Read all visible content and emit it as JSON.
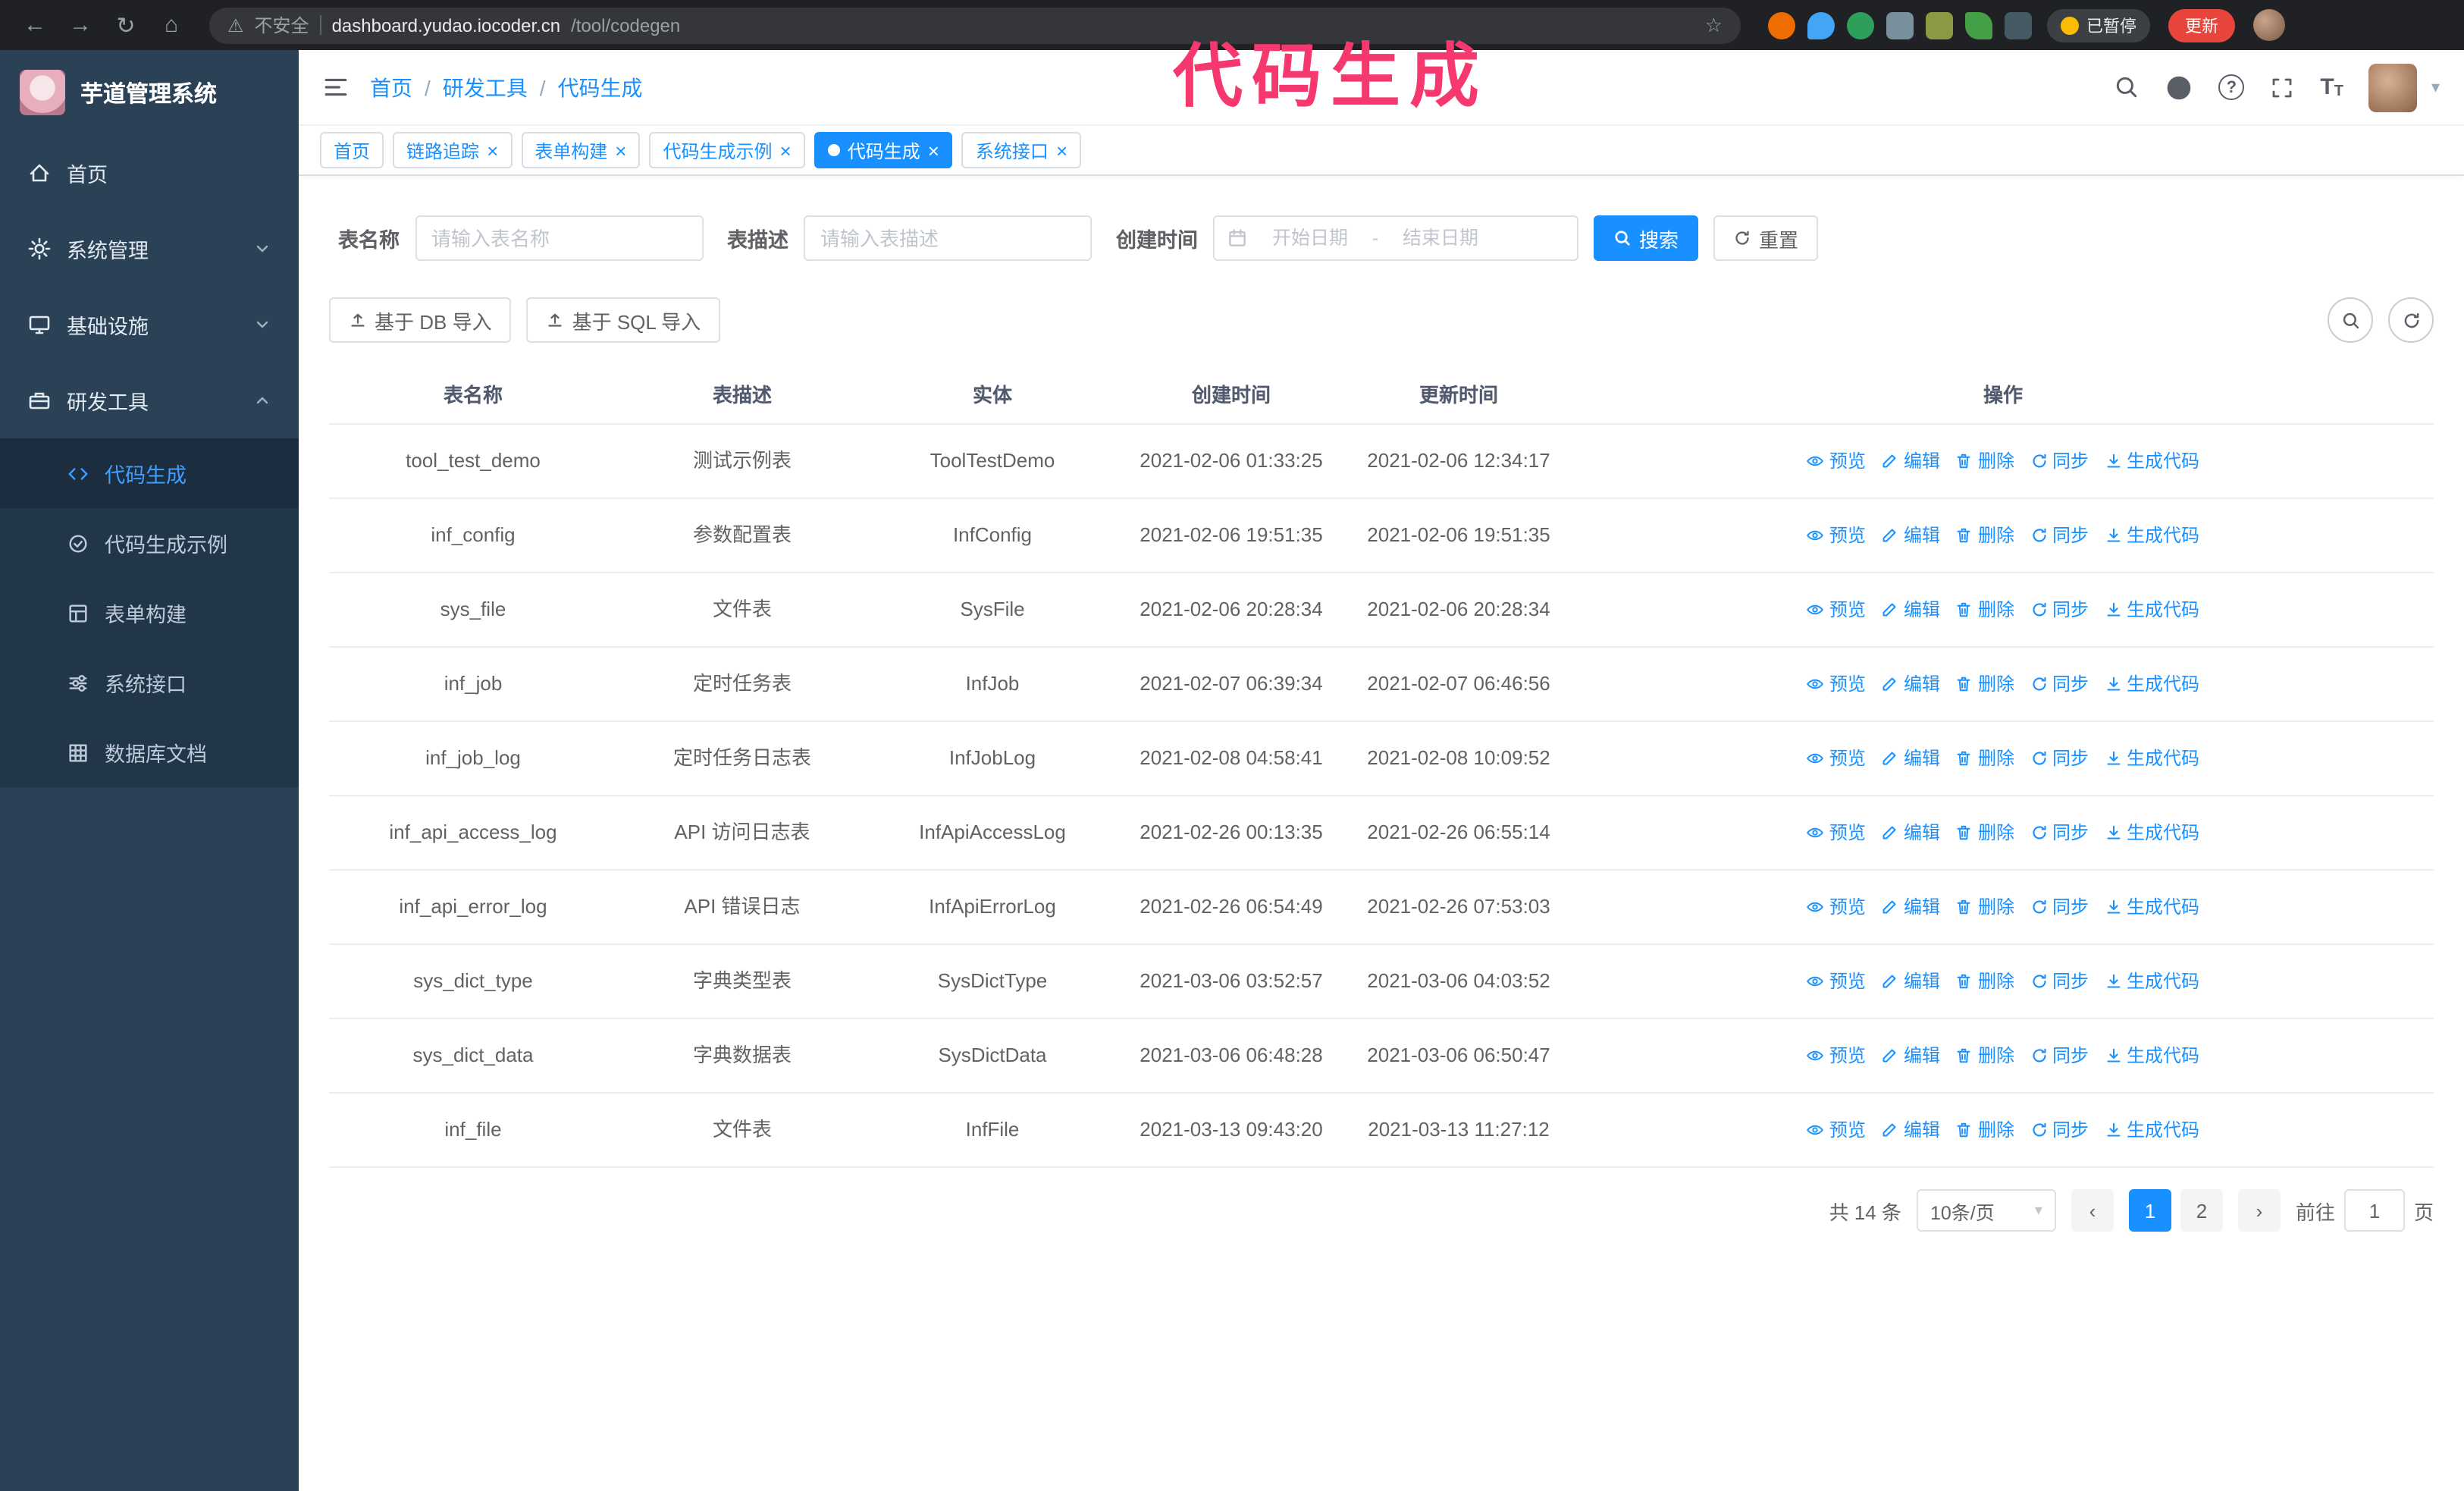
{
  "colors": {
    "accent": "#1890ff",
    "annotation": "#f5386e",
    "sidebar_bg": "#2b4156",
    "chrome_bg": "#202124",
    "update_button_bg": "#e8453c",
    "active_tab_bg": "#1890ff"
  },
  "browser": {
    "security_label": "不安全",
    "url_host": "dashboard.yudao.iocoder.cn",
    "url_path": "/tool/codegen",
    "paused_badge": "已暂停",
    "update_button": "更新"
  },
  "annotation": {
    "text": "代码生成"
  },
  "sidebar": {
    "title": "芋道管理系统",
    "items": [
      {
        "label": "首页"
      },
      {
        "label": "系统管理"
      },
      {
        "label": "基础设施"
      },
      {
        "label": "研发工具"
      }
    ],
    "subitems": [
      {
        "label": "代码生成"
      },
      {
        "label": "代码生成示例"
      },
      {
        "label": "表单构建"
      },
      {
        "label": "系统接口"
      },
      {
        "label": "数据库文档"
      }
    ]
  },
  "header": {
    "breadcrumb": [
      "首页",
      "研发工具",
      "代码生成"
    ]
  },
  "tabs": [
    {
      "label": "首页",
      "closable": false,
      "active": false
    },
    {
      "label": "链路追踪",
      "closable": true,
      "active": false
    },
    {
      "label": "表单构建",
      "closable": true,
      "active": false
    },
    {
      "label": "代码生成示例",
      "closable": true,
      "active": false
    },
    {
      "label": "代码生成",
      "closable": true,
      "active": true
    },
    {
      "label": "系统接口",
      "closable": true,
      "active": false
    }
  ],
  "filters": {
    "table_name_label": "表名称",
    "table_name_placeholder": "请输入表名称",
    "table_desc_label": "表描述",
    "table_desc_placeholder": "请输入表描述",
    "create_time_label": "创建时间",
    "date_start_placeholder": "开始日期",
    "date_separator": "-",
    "date_end_placeholder": "结束日期",
    "search_button": "搜索",
    "reset_button": "重置"
  },
  "toolbar": {
    "import_db_button": "基于 DB 导入",
    "import_sql_button": "基于 SQL 导入"
  },
  "table": {
    "columns": [
      "表名称",
      "表描述",
      "实体",
      "创建时间",
      "更新时间",
      "操作"
    ],
    "row_actions": [
      "预览",
      "编辑",
      "删除",
      "同步",
      "生成代码"
    ],
    "rows": [
      {
        "name": "tool_test_demo",
        "desc": "测试示例表",
        "entity": "ToolTestDemo",
        "created": "2021-02-06 01:33:25",
        "updated": "2021-02-06 12:34:17"
      },
      {
        "name": "inf_config",
        "desc": "参数配置表",
        "entity": "InfConfig",
        "created": "2021-02-06 19:51:35",
        "updated": "2021-02-06 19:51:35"
      },
      {
        "name": "sys_file",
        "desc": "文件表",
        "entity": "SysFile",
        "created": "2021-02-06 20:28:34",
        "updated": "2021-02-06 20:28:34"
      },
      {
        "name": "inf_job",
        "desc": "定时任务表",
        "entity": "InfJob",
        "created": "2021-02-07 06:39:34",
        "updated": "2021-02-07 06:46:56"
      },
      {
        "name": "inf_job_log",
        "desc": "定时任务日志表",
        "entity": "InfJobLog",
        "created": "2021-02-08 04:58:41",
        "updated": "2021-02-08 10:09:52"
      },
      {
        "name": "inf_api_access_log",
        "desc": "API 访问日志表",
        "entity": "InfApiAccessLog",
        "created": "2021-02-26 00:13:35",
        "updated": "2021-02-26 06:55:14"
      },
      {
        "name": "inf_api_error_log",
        "desc": "API 错误日志",
        "entity": "InfApiErrorLog",
        "created": "2021-02-26 06:54:49",
        "updated": "2021-02-26 07:53:03"
      },
      {
        "name": "sys_dict_type",
        "desc": "字典类型表",
        "entity": "SysDictType",
        "created": "2021-03-06 03:52:57",
        "updated": "2021-03-06 04:03:52"
      },
      {
        "name": "sys_dict_data",
        "desc": "字典数据表",
        "entity": "SysDictData",
        "created": "2021-03-06 06:48:28",
        "updated": "2021-03-06 06:50:47"
      },
      {
        "name": "inf_file",
        "desc": "文件表",
        "entity": "InfFile",
        "created": "2021-03-13 09:43:20",
        "updated": "2021-03-13 11:27:12"
      }
    ]
  },
  "pagination": {
    "total_text": "共 14 条",
    "page_size_text": "10条/页",
    "pages": [
      "1",
      "2"
    ],
    "active_page": "1",
    "goto_label": "前往",
    "goto_value": "1",
    "goto_unit": "页"
  },
  "icons": {
    "back": "←",
    "forward": "→",
    "reload": "↻",
    "home": "⌂",
    "warning": "⚠",
    "star": "☆",
    "caret_down": "▾",
    "close": "×",
    "breadcrumb_sep": "/",
    "question": "?",
    "text_size": "T",
    "prev": "‹",
    "next": "›"
  }
}
